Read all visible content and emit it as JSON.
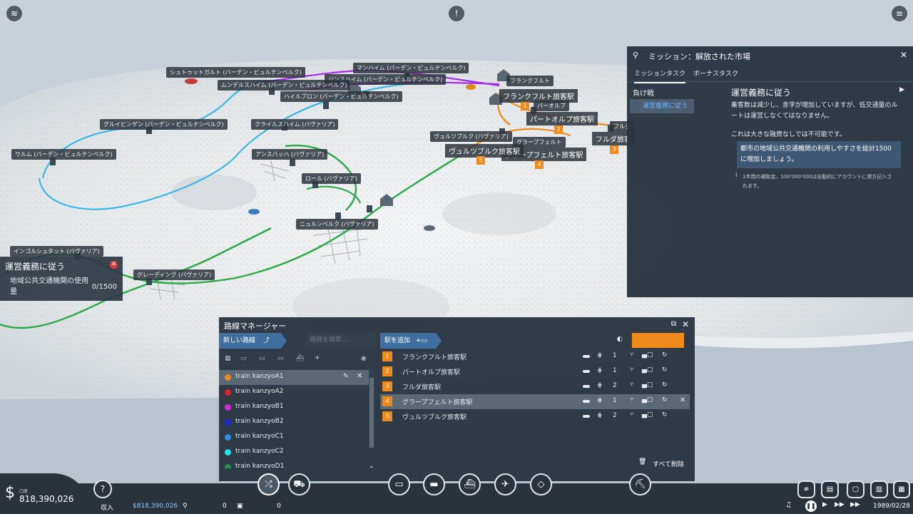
{
  "map": {
    "labels": [
      {
        "id": "stuttgart",
        "text": "シュトゥットガルト (バーデン・ビュルテンベルク)"
      },
      {
        "id": "mannheim",
        "text": "マンハイム (バーデン・ビュルテンベルク)"
      },
      {
        "id": "sinsheim",
        "text": "ジンスハイム (バーデン・ビュルテンベルク)"
      },
      {
        "id": "mundelsheim",
        "text": "ムンデルスハイム (バーデン・ビュルテンベルク)"
      },
      {
        "id": "heilbronn",
        "text": "ハイルブロン (バーデン・ビュルテンベルク)"
      },
      {
        "id": "frankfurt",
        "text": "フランクフルト"
      },
      {
        "id": "paderborn",
        "text": "パーオルブ"
      },
      {
        "id": "wurzburg",
        "text": "ヴュルツブルク (バヴァリア)"
      },
      {
        "id": "grapefelt",
        "text": "グラープフェルト"
      },
      {
        "id": "gruibingen",
        "text": "グルイビンゲン (バーデン・ビュルテンベルク)"
      },
      {
        "id": "crailsheim",
        "text": "クライルスハイム (バヴァリア)"
      },
      {
        "id": "ulm",
        "text": "ウルム (バーデン・ビュルテンベルク)"
      },
      {
        "id": "ansbach",
        "text": "アンスバッハ (バヴァリア)"
      },
      {
        "id": "roth",
        "text": "ロール (バヴァリア)"
      },
      {
        "id": "nurnberg",
        "text": "ニュルンベルク (バヴァリア)"
      },
      {
        "id": "ingolstadt",
        "text": "インゴルシュタット (バヴァリア)"
      },
      {
        "id": "greding",
        "text": "グレーディング (バヴァリア)"
      },
      {
        "id": "fulda",
        "text": "フルダ"
      }
    ],
    "stations": [
      {
        "id": "frankfurt-st",
        "text": "フランクフルト旅客駅",
        "num": "1"
      },
      {
        "id": "paderborn-st",
        "text": "パートオルプ旅客駅",
        "num": "2"
      },
      {
        "id": "fulda-st",
        "text": "フルダ旅客",
        "num": "3"
      },
      {
        "id": "grape-st",
        "text": "グラープフェルト旅客駅",
        "num": "4"
      },
      {
        "id": "wurz-st",
        "text": "ヴュルツブルク旅客駅",
        "num": "5"
      }
    ]
  },
  "tracker": {
    "title": "運営義務に従う",
    "close_icon": "✕",
    "description": "地域公共交通機関の使用量",
    "progress": "0/1500"
  },
  "mission": {
    "title": "ミッション：解放された市場",
    "tabs": [
      "ミッションタスク",
      "ボーナスタスク"
    ],
    "category": "負け戦",
    "item": "運営義務に従う",
    "task_title": "運営義務に従う",
    "description": "乗客数は減少し、赤字が増加していますが、低交通量のルートは運営しなくてはなりません。",
    "description2": "これは大きな融資なしでは不可能です。",
    "goal": "都市の地域公共交通機関の利用しやすさを総計1500に増加しましょう。",
    "note": "1年間の補助金、100'000'000は自動的にアカウントに貸方記入されます。"
  },
  "line_manager": {
    "title": "路線マネージャー",
    "new_line": "新しい路線",
    "search_placeholder": "路線を検索…",
    "add_station": "駅を追加",
    "accent_color": "#f08a1a",
    "lines": [
      {
        "name": "train kanzyoA1",
        "color": "#f08a1a"
      },
      {
        "name": "train kanzyoA2",
        "color": "#e02424"
      },
      {
        "name": "train kanzyoB1",
        "color": "#d92ad9"
      },
      {
        "name": "train kanzyoB2",
        "color": "#1c2bd6"
      },
      {
        "name": "train kanzyoC1",
        "color": "#2a8fe6"
      },
      {
        "name": "train kanzyoC2",
        "color": "#22e6e6"
      },
      {
        "name": "train kanzyoD1",
        "color": "#1e9a4a"
      }
    ],
    "stations": [
      {
        "num": "1",
        "name": "フランクフルト旅客駅",
        "tracks": "1"
      },
      {
        "num": "2",
        "name": "パートオルプ旅客駅",
        "tracks": "1"
      },
      {
        "num": "3",
        "name": "フルダ旅客駅",
        "tracks": "2"
      },
      {
        "num": "4",
        "name": "グラープフェルト旅客駅",
        "tracks": "1"
      },
      {
        "num": "5",
        "name": "ヴュルツブルク旅客駅",
        "tracks": "2"
      }
    ],
    "clear_all": "すべて削除"
  },
  "bottom": {
    "account_label": "口座",
    "balance": "818,390,026",
    "income_label": "収入",
    "income_value": "$818,390,026",
    "passengers": "0",
    "cargo": "0",
    "date": "1989/02/28"
  }
}
